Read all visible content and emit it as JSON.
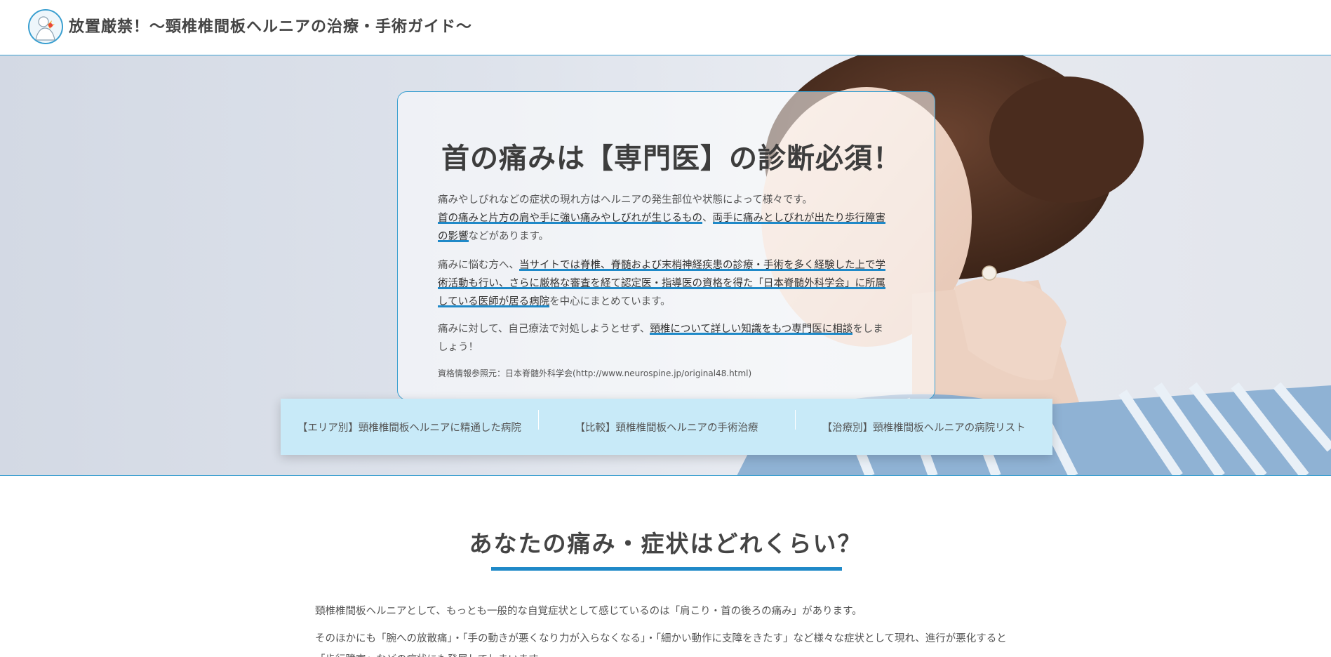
{
  "header": {
    "site_title": "放置厳禁！〜頸椎椎間板ヘルニアの治療・手術ガイド〜",
    "logo_icon": "neck-pain-logo-icon"
  },
  "hero": {
    "title": "首の痛みは【専門医】の診断必須！",
    "p1": {
      "t1": "痛みやしびれなどの症状の現れ方はヘルニアの発生部位や状態によって様々です。",
      "h1": "首の痛みと片方の肩や手に強い痛みやしびれが生じるもの",
      "t2": "、",
      "h2": "両手に痛みとしびれが出たり歩行障害の影響",
      "t3": "などがあります。"
    },
    "p2": {
      "t1": "痛みに悩む方へ、",
      "h1": "当サイトでは脊椎、脊髄および末梢神経疾患の診療・手術を多く経験した上で学術活動も行い、さらに厳格な審査を経て認定医・指導医の資格を得た「日本脊髄外科学会」に所属している医師が居る病院",
      "t2": "を中心にまとめています。"
    },
    "p3": {
      "t1": "痛みに対して、自己療法で対処しようとせず、",
      "h1": "頸椎について詳しい知識をもつ専門医に相談",
      "t2": "をしましょう！"
    },
    "source": "資格情報参照元：日本脊髄外科学会(http://www.neurospine.jp/original48.html)",
    "nav": [
      "【エリア別】頸椎椎間板ヘルニアに精通した病院",
      "【比較】頸椎椎間板ヘルニアの手術治療",
      "【治療別】頸椎椎間板ヘルニアの病院リスト"
    ]
  },
  "section": {
    "title": "あなたの痛み・症状はどれくらい？",
    "b1": "頸椎椎間板ヘルニアとして、もっとも一般的な自覚症状として感じているのは「肩こり・首の後ろの痛み」があります。",
    "b2": "そのほかにも「腕への放散痛」・「手の動きが悪くなり力が入らなくなる」・「細かい動作に支障をきたす」など様々な症状として現れ、進行が悪化すると「歩行障害」などの症状にも発展してしまいます。"
  },
  "colors": {
    "accent": "#1f89c8",
    "nav_bg": "#c8eaf8",
    "border": "#3a9fd0"
  }
}
